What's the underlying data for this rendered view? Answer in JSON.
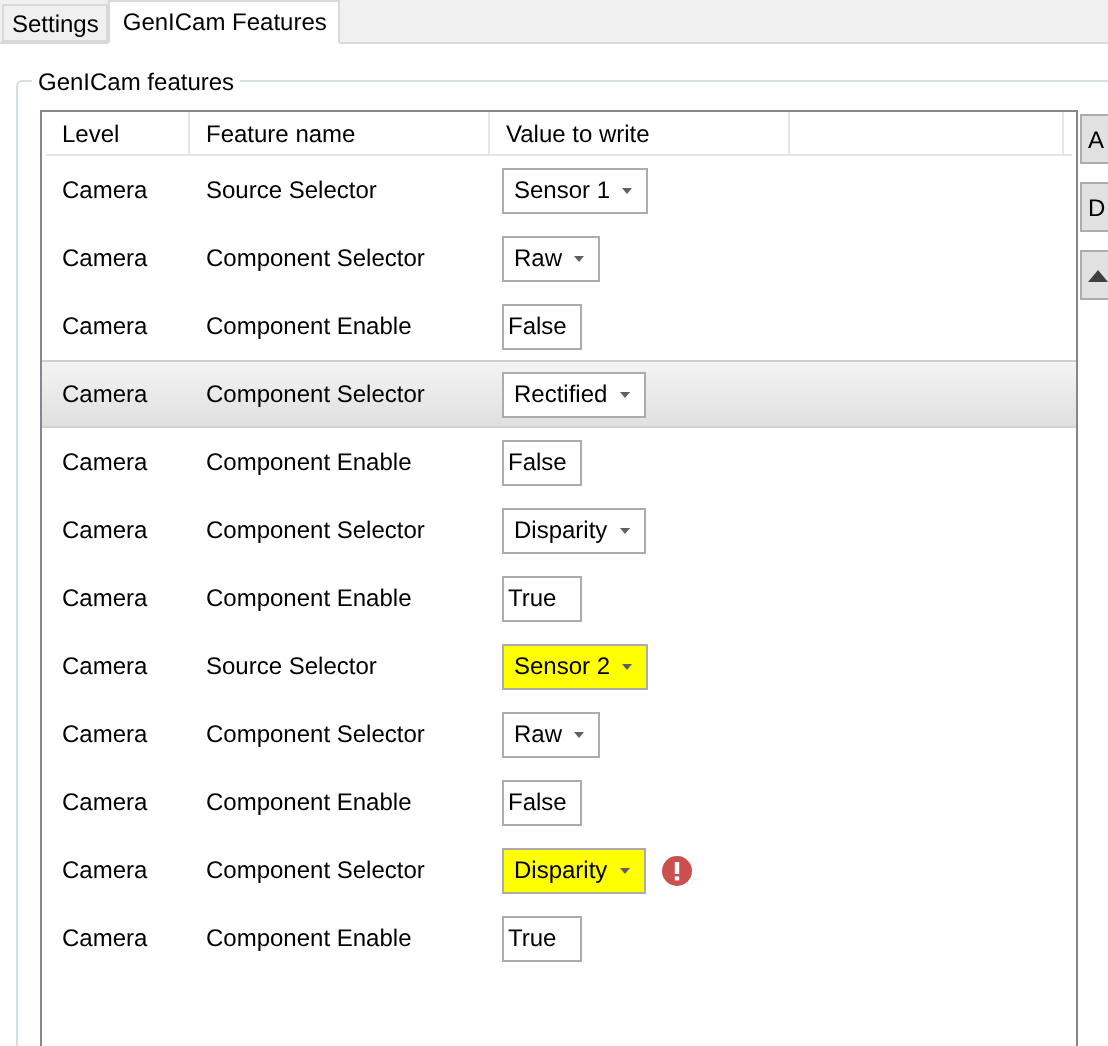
{
  "tabs": [
    {
      "label": "Settings",
      "selected": false
    },
    {
      "label": "GenICam Features",
      "selected": true
    }
  ],
  "group": {
    "title": "GenICam features"
  },
  "table": {
    "columns": [
      "Level",
      "Feature name",
      "Value to write"
    ],
    "rows": [
      {
        "level": "Camera",
        "feature": "Source Selector",
        "value": {
          "kind": "combo",
          "text": "Sensor 1",
          "highlighted": false
        },
        "error": false,
        "selected": false
      },
      {
        "level": "Camera",
        "feature": "Component Selector",
        "value": {
          "kind": "combo",
          "text": "Raw",
          "highlighted": false
        },
        "error": false,
        "selected": false
      },
      {
        "level": "Camera",
        "feature": "Component Enable",
        "value": {
          "kind": "text",
          "text": "False",
          "highlighted": false
        },
        "error": false,
        "selected": false
      },
      {
        "level": "Camera",
        "feature": "Component Selector",
        "value": {
          "kind": "combo",
          "text": "Rectified",
          "highlighted": false
        },
        "error": false,
        "selected": true
      },
      {
        "level": "Camera",
        "feature": "Component Enable",
        "value": {
          "kind": "text",
          "text": "False",
          "highlighted": false
        },
        "error": false,
        "selected": false
      },
      {
        "level": "Camera",
        "feature": "Component Selector",
        "value": {
          "kind": "combo",
          "text": "Disparity",
          "highlighted": false
        },
        "error": false,
        "selected": false
      },
      {
        "level": "Camera",
        "feature": "Component Enable",
        "value": {
          "kind": "text",
          "text": "True",
          "highlighted": false
        },
        "error": false,
        "selected": false
      },
      {
        "level": "Camera",
        "feature": "Source Selector",
        "value": {
          "kind": "combo",
          "text": "Sensor 2",
          "highlighted": true
        },
        "error": false,
        "selected": false
      },
      {
        "level": "Camera",
        "feature": "Component Selector",
        "value": {
          "kind": "combo",
          "text": "Raw",
          "highlighted": false
        },
        "error": false,
        "selected": false
      },
      {
        "level": "Camera",
        "feature": "Component Enable",
        "value": {
          "kind": "text",
          "text": "False",
          "highlighted": false
        },
        "error": false,
        "selected": false
      },
      {
        "level": "Camera",
        "feature": "Component Selector",
        "value": {
          "kind": "combo",
          "text": "Disparity",
          "highlighted": true
        },
        "error": true,
        "selected": false
      },
      {
        "level": "Camera",
        "feature": "Component Enable",
        "value": {
          "kind": "text",
          "text": "True",
          "highlighted": false
        },
        "error": false,
        "selected": false
      }
    ]
  },
  "side_buttons": [
    {
      "kind": "text",
      "label": "A"
    },
    {
      "kind": "text",
      "label": "D"
    },
    {
      "kind": "up"
    }
  ]
}
